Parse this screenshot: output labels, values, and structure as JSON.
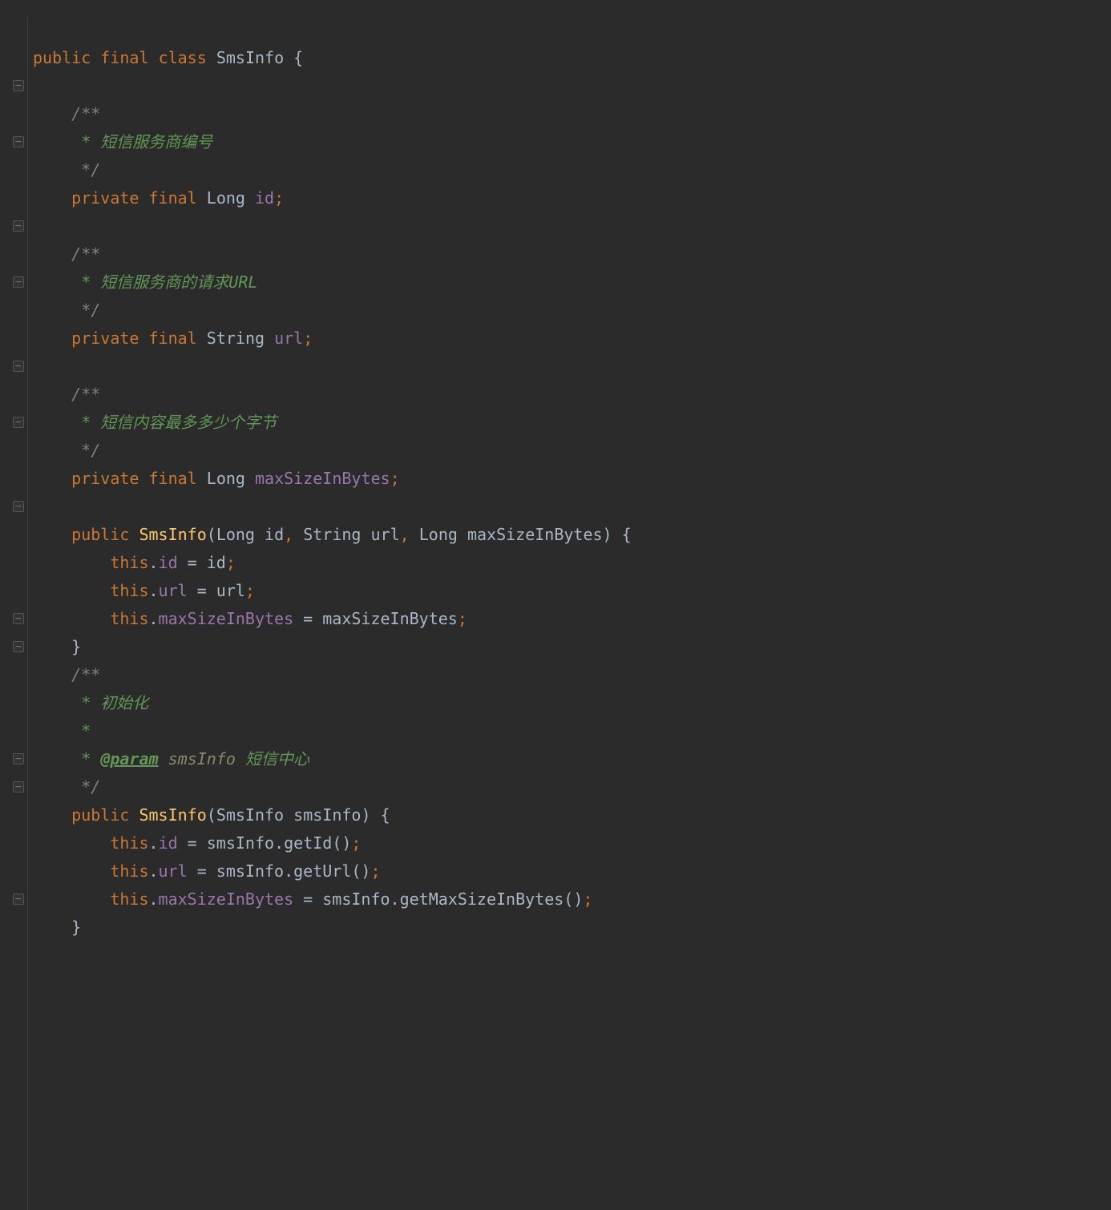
{
  "code": {
    "keyword_public": "public",
    "keyword_final": "final",
    "keyword_class": "class",
    "class_name": "SmsInfo",
    "open_brace": "{",
    "close_brace": "}",
    "doc_open": "/**",
    "doc_close": " */",
    "doc_star": " *",
    "doc_id": " * 短信服务商编号",
    "doc_url": " * 短信服务商的请求URL",
    "doc_max": " * 短信内容最多多少个字节",
    "doc_init": " * 初始化",
    "doc_param_tag": "@param",
    "doc_param_var": "smsInfo",
    "doc_param_desc": "短信中心",
    "keyword_private": "private",
    "type_Long": "Long",
    "type_String": "String",
    "field_id": "id",
    "field_url": "url",
    "field_max": "maxSizeInBytes",
    "comma": ", ",
    "semi": ";",
    "paren_open": "(",
    "paren_close": ")",
    "kw_this": "this",
    "dot": ".",
    "eq": " = ",
    "getId": "getId()",
    "getUrl": "getUrl()",
    "getMax": "getMaxSizeInBytes()"
  },
  "gutter": {
    "collapse": "−",
    "expand": "−"
  }
}
